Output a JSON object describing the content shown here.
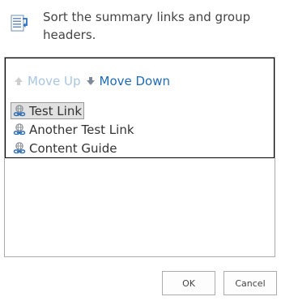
{
  "header": {
    "description": "Sort the summary links and group headers.",
    "icon": "sort-list-icon"
  },
  "toolbar": {
    "move_up_label": "Move Up",
    "move_down_label": "Move Down",
    "move_up_icon": "arrow-up-icon",
    "move_down_icon": "arrow-down-icon",
    "colors": {
      "disabled": "#a8c6e3",
      "enabled": "#1f6bb6"
    }
  },
  "links": [
    {
      "label": "Test Link",
      "selected": true,
      "icon": "link-icon"
    },
    {
      "label": "Another Test Link",
      "selected": false,
      "icon": "link-icon"
    },
    {
      "label": "Content Guide",
      "selected": false,
      "icon": "link-icon"
    }
  ],
  "buttons": {
    "ok_label": "OK",
    "cancel_label": "Cancel"
  }
}
